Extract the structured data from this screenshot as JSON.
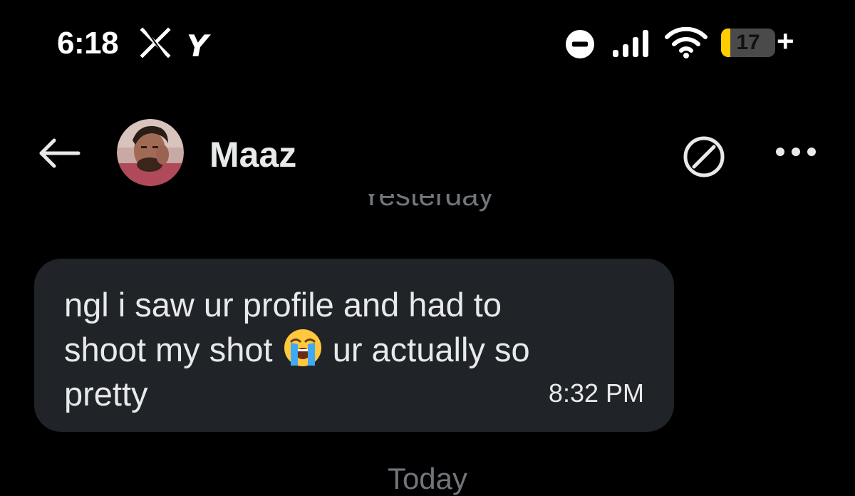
{
  "status_bar": {
    "time": "6:18",
    "app_icon_1": "x-logo-icon",
    "app_icon_2": "y-app-icon",
    "y_glyph": "Y",
    "battery_level": "17",
    "battery_fill_percent": 17,
    "battery_charging": "+",
    "colors": {
      "battery_fill": "#ffcc00"
    }
  },
  "header": {
    "back_icon": "back-arrow-icon",
    "contact_name": "Maaz",
    "block_icon": "block-icon",
    "more_icon": "more-options-icon"
  },
  "conversation": {
    "date_separator_top": "Yesterday",
    "message": {
      "text_before_emoji": "ngl i saw ur profile and had to\nshoot my shot ",
      "emoji": "loudly-crying-face-emoji",
      "text_after_emoji": " ur actually so\npretty",
      "time": "8:32 PM"
    },
    "date_separator_bottom": "Today"
  },
  "colors": {
    "background": "#000000",
    "bubble": "#202327",
    "primary_text": "#e7e9ea",
    "secondary_text": "#71767b"
  }
}
